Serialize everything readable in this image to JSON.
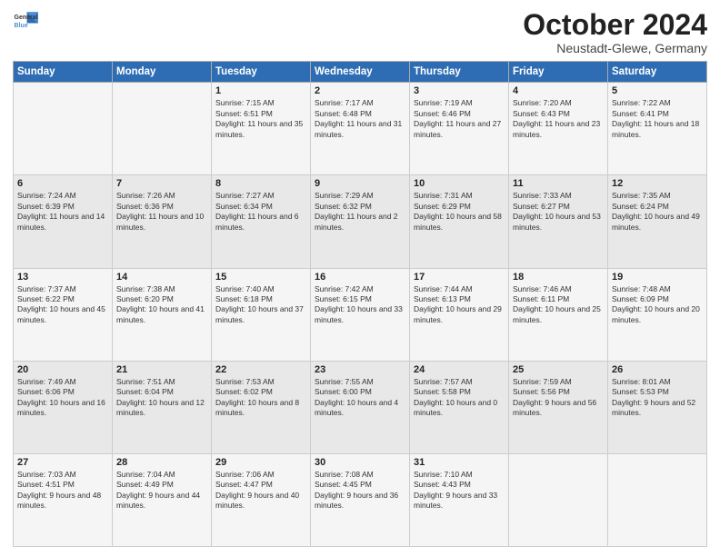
{
  "header": {
    "logo_line1": "General",
    "logo_line2": "Blue",
    "month": "October 2024",
    "location": "Neustadt-Glewe, Germany"
  },
  "weekdays": [
    "Sunday",
    "Monday",
    "Tuesday",
    "Wednesday",
    "Thursday",
    "Friday",
    "Saturday"
  ],
  "weeks": [
    [
      {
        "day": "",
        "sunrise": "",
        "sunset": "",
        "daylight": ""
      },
      {
        "day": "",
        "sunrise": "",
        "sunset": "",
        "daylight": ""
      },
      {
        "day": "1",
        "sunrise": "Sunrise: 7:15 AM",
        "sunset": "Sunset: 6:51 PM",
        "daylight": "Daylight: 11 hours and 35 minutes."
      },
      {
        "day": "2",
        "sunrise": "Sunrise: 7:17 AM",
        "sunset": "Sunset: 6:48 PM",
        "daylight": "Daylight: 11 hours and 31 minutes."
      },
      {
        "day": "3",
        "sunrise": "Sunrise: 7:19 AM",
        "sunset": "Sunset: 6:46 PM",
        "daylight": "Daylight: 11 hours and 27 minutes."
      },
      {
        "day": "4",
        "sunrise": "Sunrise: 7:20 AM",
        "sunset": "Sunset: 6:43 PM",
        "daylight": "Daylight: 11 hours and 23 minutes."
      },
      {
        "day": "5",
        "sunrise": "Sunrise: 7:22 AM",
        "sunset": "Sunset: 6:41 PM",
        "daylight": "Daylight: 11 hours and 18 minutes."
      }
    ],
    [
      {
        "day": "6",
        "sunrise": "Sunrise: 7:24 AM",
        "sunset": "Sunset: 6:39 PM",
        "daylight": "Daylight: 11 hours and 14 minutes."
      },
      {
        "day": "7",
        "sunrise": "Sunrise: 7:26 AM",
        "sunset": "Sunset: 6:36 PM",
        "daylight": "Daylight: 11 hours and 10 minutes."
      },
      {
        "day": "8",
        "sunrise": "Sunrise: 7:27 AM",
        "sunset": "Sunset: 6:34 PM",
        "daylight": "Daylight: 11 hours and 6 minutes."
      },
      {
        "day": "9",
        "sunrise": "Sunrise: 7:29 AM",
        "sunset": "Sunset: 6:32 PM",
        "daylight": "Daylight: 11 hours and 2 minutes."
      },
      {
        "day": "10",
        "sunrise": "Sunrise: 7:31 AM",
        "sunset": "Sunset: 6:29 PM",
        "daylight": "Daylight: 10 hours and 58 minutes."
      },
      {
        "day": "11",
        "sunrise": "Sunrise: 7:33 AM",
        "sunset": "Sunset: 6:27 PM",
        "daylight": "Daylight: 10 hours and 53 minutes."
      },
      {
        "day": "12",
        "sunrise": "Sunrise: 7:35 AM",
        "sunset": "Sunset: 6:24 PM",
        "daylight": "Daylight: 10 hours and 49 minutes."
      }
    ],
    [
      {
        "day": "13",
        "sunrise": "Sunrise: 7:37 AM",
        "sunset": "Sunset: 6:22 PM",
        "daylight": "Daylight: 10 hours and 45 minutes."
      },
      {
        "day": "14",
        "sunrise": "Sunrise: 7:38 AM",
        "sunset": "Sunset: 6:20 PM",
        "daylight": "Daylight: 10 hours and 41 minutes."
      },
      {
        "day": "15",
        "sunrise": "Sunrise: 7:40 AM",
        "sunset": "Sunset: 6:18 PM",
        "daylight": "Daylight: 10 hours and 37 minutes."
      },
      {
        "day": "16",
        "sunrise": "Sunrise: 7:42 AM",
        "sunset": "Sunset: 6:15 PM",
        "daylight": "Daylight: 10 hours and 33 minutes."
      },
      {
        "day": "17",
        "sunrise": "Sunrise: 7:44 AM",
        "sunset": "Sunset: 6:13 PM",
        "daylight": "Daylight: 10 hours and 29 minutes."
      },
      {
        "day": "18",
        "sunrise": "Sunrise: 7:46 AM",
        "sunset": "Sunset: 6:11 PM",
        "daylight": "Daylight: 10 hours and 25 minutes."
      },
      {
        "day": "19",
        "sunrise": "Sunrise: 7:48 AM",
        "sunset": "Sunset: 6:09 PM",
        "daylight": "Daylight: 10 hours and 20 minutes."
      }
    ],
    [
      {
        "day": "20",
        "sunrise": "Sunrise: 7:49 AM",
        "sunset": "Sunset: 6:06 PM",
        "daylight": "Daylight: 10 hours and 16 minutes."
      },
      {
        "day": "21",
        "sunrise": "Sunrise: 7:51 AM",
        "sunset": "Sunset: 6:04 PM",
        "daylight": "Daylight: 10 hours and 12 minutes."
      },
      {
        "day": "22",
        "sunrise": "Sunrise: 7:53 AM",
        "sunset": "Sunset: 6:02 PM",
        "daylight": "Daylight: 10 hours and 8 minutes."
      },
      {
        "day": "23",
        "sunrise": "Sunrise: 7:55 AM",
        "sunset": "Sunset: 6:00 PM",
        "daylight": "Daylight: 10 hours and 4 minutes."
      },
      {
        "day": "24",
        "sunrise": "Sunrise: 7:57 AM",
        "sunset": "Sunset: 5:58 PM",
        "daylight": "Daylight: 10 hours and 0 minutes."
      },
      {
        "day": "25",
        "sunrise": "Sunrise: 7:59 AM",
        "sunset": "Sunset: 5:56 PM",
        "daylight": "Daylight: 9 hours and 56 minutes."
      },
      {
        "day": "26",
        "sunrise": "Sunrise: 8:01 AM",
        "sunset": "Sunset: 5:53 PM",
        "daylight": "Daylight: 9 hours and 52 minutes."
      }
    ],
    [
      {
        "day": "27",
        "sunrise": "Sunrise: 7:03 AM",
        "sunset": "Sunset: 4:51 PM",
        "daylight": "Daylight: 9 hours and 48 minutes."
      },
      {
        "day": "28",
        "sunrise": "Sunrise: 7:04 AM",
        "sunset": "Sunset: 4:49 PM",
        "daylight": "Daylight: 9 hours and 44 minutes."
      },
      {
        "day": "29",
        "sunrise": "Sunrise: 7:06 AM",
        "sunset": "Sunset: 4:47 PM",
        "daylight": "Daylight: 9 hours and 40 minutes."
      },
      {
        "day": "30",
        "sunrise": "Sunrise: 7:08 AM",
        "sunset": "Sunset: 4:45 PM",
        "daylight": "Daylight: 9 hours and 36 minutes."
      },
      {
        "day": "31",
        "sunrise": "Sunrise: 7:10 AM",
        "sunset": "Sunset: 4:43 PM",
        "daylight": "Daylight: 9 hours and 33 minutes."
      },
      {
        "day": "",
        "sunrise": "",
        "sunset": "",
        "daylight": ""
      },
      {
        "day": "",
        "sunrise": "",
        "sunset": "",
        "daylight": ""
      }
    ]
  ]
}
